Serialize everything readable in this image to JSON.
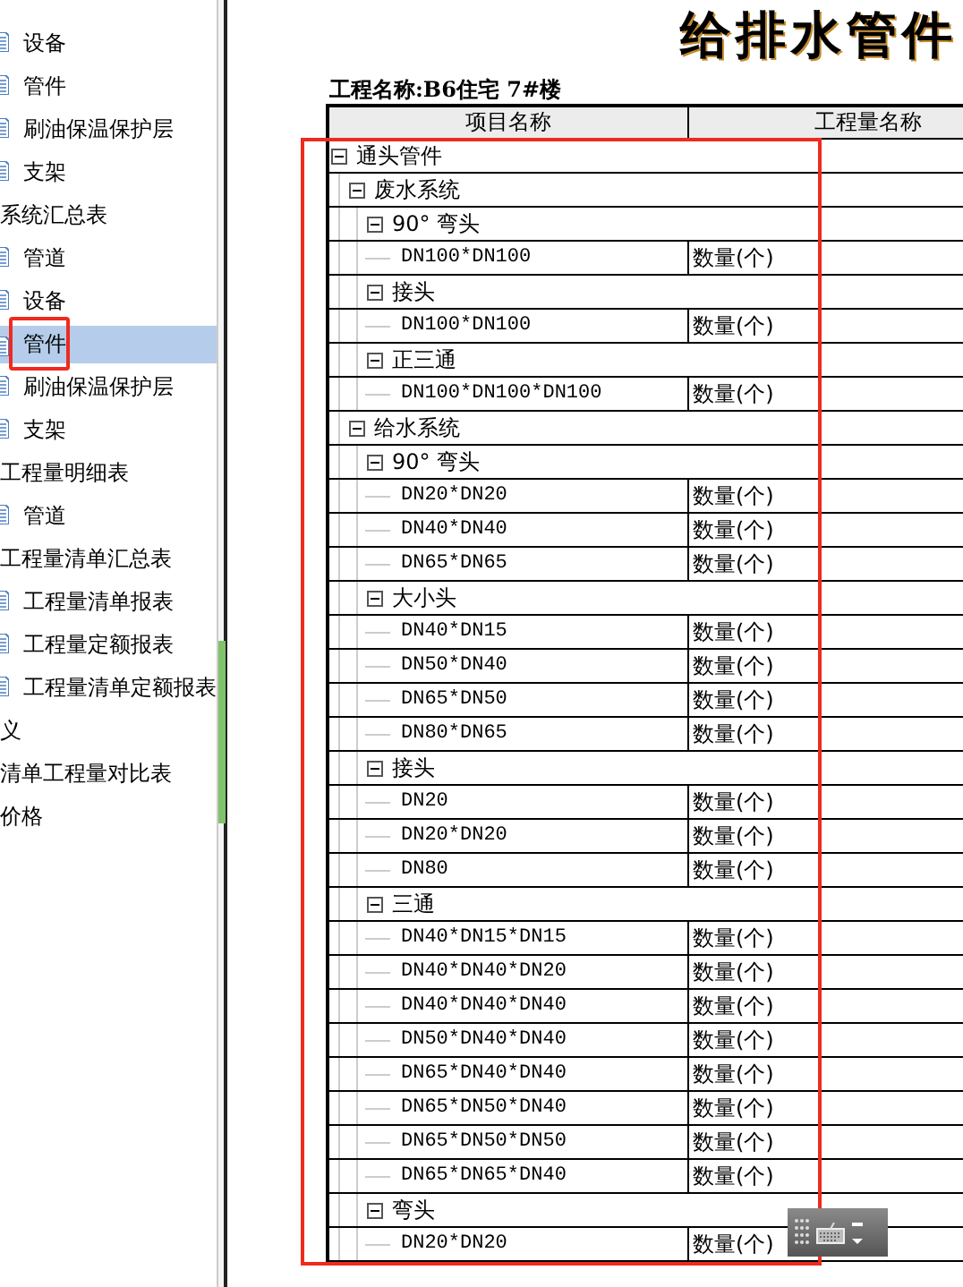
{
  "sidebar": {
    "items": [
      {
        "label": "设备",
        "kind": "report",
        "selected": false,
        "annotated": false
      },
      {
        "label": "管件",
        "kind": "report",
        "selected": false,
        "annotated": false
      },
      {
        "label": "刷油保温保护层",
        "kind": "report",
        "selected": false,
        "annotated": false
      },
      {
        "label": "支架",
        "kind": "report",
        "selected": false,
        "annotated": false
      },
      {
        "label": "系统汇总表",
        "kind": "group",
        "selected": false,
        "annotated": false
      },
      {
        "label": "管道",
        "kind": "report",
        "selected": false,
        "annotated": false
      },
      {
        "label": "设备",
        "kind": "report",
        "selected": false,
        "annotated": false
      },
      {
        "label": "管件",
        "kind": "report",
        "selected": true,
        "annotated": true
      },
      {
        "label": "刷油保温保护层",
        "kind": "report",
        "selected": false,
        "annotated": false
      },
      {
        "label": "支架",
        "kind": "report",
        "selected": false,
        "annotated": false
      },
      {
        "label": "工程量明细表",
        "kind": "group",
        "selected": false,
        "annotated": false
      },
      {
        "label": "管道",
        "kind": "report",
        "selected": false,
        "annotated": false
      },
      {
        "label": "工程量清单汇总表",
        "kind": "group",
        "selected": false,
        "annotated": false
      },
      {
        "label": "工程量清单报表",
        "kind": "report",
        "selected": false,
        "annotated": false
      },
      {
        "label": "工程量定额报表",
        "kind": "report",
        "selected": false,
        "annotated": false
      },
      {
        "label": "工程量清单定额报表",
        "kind": "report",
        "selected": false,
        "annotated": false
      },
      {
        "label": "义",
        "kind": "group",
        "selected": false,
        "annotated": false
      },
      {
        "label": "清单工程量对比表",
        "kind": "group",
        "selected": false,
        "annotated": false
      },
      {
        "label": "价格",
        "kind": "group",
        "selected": false,
        "annotated": false
      }
    ]
  },
  "report": {
    "title": "给排水管件",
    "project": "工程名称:B6住宅 7#楼"
  },
  "table": {
    "annotated": true,
    "columns": [
      "项目名称",
      "工程量名称"
    ],
    "rows": [
      {
        "name": "通头管件",
        "expanded": true,
        "children": [
          {
            "name": "废水系统",
            "expanded": true,
            "children": [
              {
                "name": "90° 弯头",
                "expanded": true,
                "children": [
                  {
                    "name": "DN100*DN100",
                    "unit": "数量(个)"
                  }
                ]
              },
              {
                "name": "接头",
                "expanded": true,
                "children": [
                  {
                    "name": "DN100*DN100",
                    "unit": "数量(个)"
                  }
                ]
              },
              {
                "name": "正三通",
                "expanded": true,
                "children": [
                  {
                    "name": "DN100*DN100*DN100",
                    "unit": "数量(个)"
                  }
                ]
              }
            ]
          },
          {
            "name": "给水系统",
            "expanded": true,
            "children": [
              {
                "name": "90° 弯头",
                "expanded": true,
                "children": [
                  {
                    "name": "DN20*DN20",
                    "unit": "数量(个)"
                  },
                  {
                    "name": "DN40*DN40",
                    "unit": "数量(个)"
                  },
                  {
                    "name": "DN65*DN65",
                    "unit": "数量(个)"
                  }
                ]
              },
              {
                "name": "大小头",
                "expanded": true,
                "children": [
                  {
                    "name": "DN40*DN15",
                    "unit": "数量(个)"
                  },
                  {
                    "name": "DN50*DN40",
                    "unit": "数量(个)"
                  },
                  {
                    "name": "DN65*DN50",
                    "unit": "数量(个)"
                  },
                  {
                    "name": "DN80*DN65",
                    "unit": "数量(个)"
                  }
                ]
              },
              {
                "name": "接头",
                "expanded": true,
                "children": [
                  {
                    "name": "DN20",
                    "unit": "数量(个)"
                  },
                  {
                    "name": "DN20*DN20",
                    "unit": "数量(个)"
                  },
                  {
                    "name": "DN80",
                    "unit": "数量(个)"
                  }
                ]
              },
              {
                "name": "三通",
                "expanded": true,
                "children": [
                  {
                    "name": "DN40*DN15*DN15",
                    "unit": "数量(个)"
                  },
                  {
                    "name": "DN40*DN40*DN20",
                    "unit": "数量(个)"
                  },
                  {
                    "name": "DN40*DN40*DN40",
                    "unit": "数量(个)"
                  },
                  {
                    "name": "DN50*DN40*DN40",
                    "unit": "数量(个)"
                  },
                  {
                    "name": "DN65*DN40*DN40",
                    "unit": "数量(个)"
                  },
                  {
                    "name": "DN65*DN50*DN40",
                    "unit": "数量(个)"
                  },
                  {
                    "name": "DN65*DN50*DN50",
                    "unit": "数量(个)"
                  },
                  {
                    "name": "DN65*DN65*DN40",
                    "unit": "数量(个)"
                  }
                ]
              },
              {
                "name": "弯头",
                "expanded": true,
                "children": [
                  {
                    "name": "DN20*DN20",
                    "unit": "数量(个)"
                  }
                ]
              }
            ]
          }
        ]
      }
    ]
  }
}
